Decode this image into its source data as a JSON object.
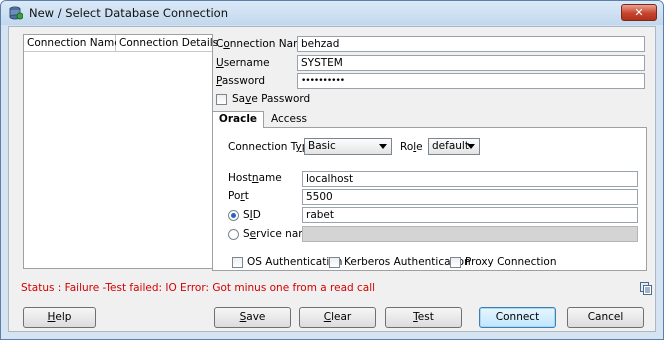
{
  "window": {
    "title": "New / Select Database Connection",
    "close_label": "✕"
  },
  "connections_table": {
    "columns": [
      "Connection Name",
      "Connection Details"
    ]
  },
  "form": {
    "connection_name": {
      "label_prefix": "C",
      "label_accel": "o",
      "label_rest": "nnection Name",
      "value": "behzad"
    },
    "username": {
      "label_accel": "U",
      "label_rest": "sername",
      "value": "SYSTEM"
    },
    "password": {
      "label_accel": "P",
      "label_rest": "assword",
      "value": "••••••••••"
    },
    "save_password": {
      "label_prefix": "Sa",
      "label_accel": "v",
      "label_rest": "e Password",
      "checked": false
    }
  },
  "tabs": [
    {
      "label": "Oracle",
      "selected": true
    },
    {
      "label": "Access",
      "selected": false
    }
  ],
  "oracle": {
    "connection_type": {
      "label_prefix": "Connection T",
      "label_accel": "y",
      "label_rest": "pe",
      "value": "Basic"
    },
    "role": {
      "label_prefix": "Ro",
      "label_accel": "l",
      "label_rest": "e",
      "value": "default"
    },
    "hostname": {
      "label_prefix": "Host",
      "label_accel": "n",
      "label_rest": "ame",
      "value": "localhost"
    },
    "port": {
      "label_prefix": "Po",
      "label_accel": "r",
      "label_rest": "t",
      "value": "5500"
    },
    "sid": {
      "label_prefix": "S",
      "label_accel": "I",
      "label_rest": "D",
      "value": "rabet",
      "selected": true
    },
    "service_name": {
      "label_prefix": "S",
      "label_accel": "e",
      "label_rest": "rvice name",
      "value": "",
      "selected": false
    },
    "os_auth": {
      "label": "OS Authentication",
      "checked": false
    },
    "kerberos_auth": {
      "label": "Kerberos Authentication",
      "checked": false
    },
    "proxy": {
      "label": "Proxy Connection",
      "checked": false
    }
  },
  "status_text": "Status : Failure -Test failed: IO Error: Got minus one from a read call",
  "buttons": {
    "help": {
      "accel": "H",
      "rest": "elp"
    },
    "save": {
      "accel": "S",
      "rest": "ave"
    },
    "clear": {
      "accel": "C",
      "rest": "lear"
    },
    "test": {
      "accel": "T",
      "rest": "est"
    },
    "connect": {
      "label": "Connect"
    },
    "cancel": {
      "label": "Cancel"
    }
  },
  "colors": {
    "status_error": "#d40000",
    "titlebar": "#c3d8ee",
    "close_button": "#c9442c"
  },
  "icons": {
    "app": "database-connection-icon",
    "close": "close-icon",
    "copy": "copy-icon"
  }
}
